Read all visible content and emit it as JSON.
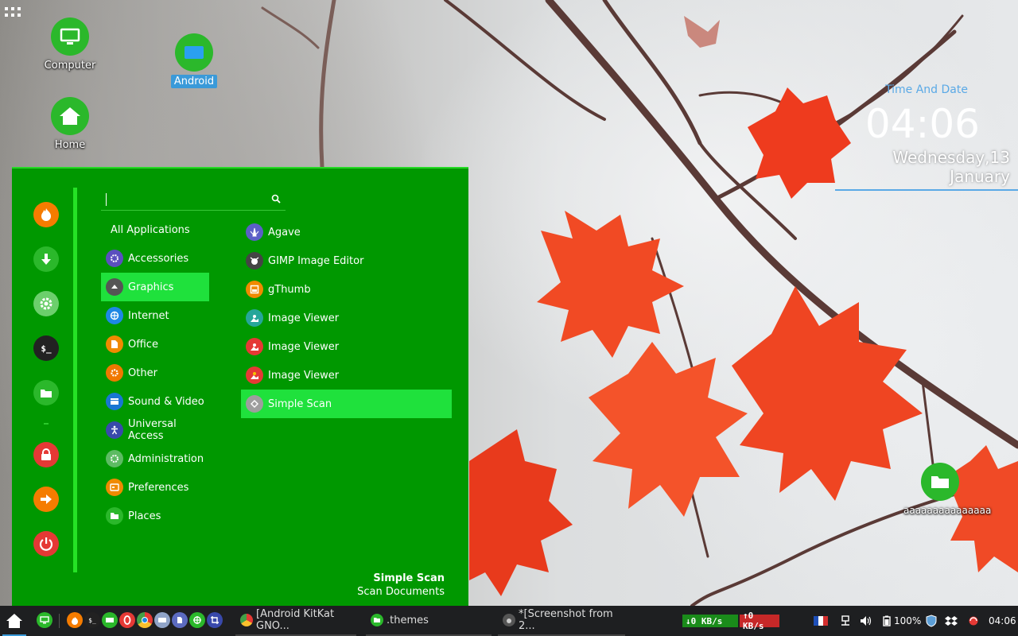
{
  "desktop": {
    "icons": [
      {
        "label": "Computer"
      },
      {
        "label": "Android"
      },
      {
        "label": "Home"
      },
      {
        "label": "aaaaaaaaaaaaaaa"
      }
    ]
  },
  "clock": {
    "title": "Time And Date",
    "time": "04:06",
    "date": "Wednesday,13 January"
  },
  "menu": {
    "search": {
      "value": "",
      "placeholder": ""
    },
    "categories": [
      {
        "label": "All Applications",
        "icon": "none"
      },
      {
        "label": "Accessories",
        "icon": "accessories-icon",
        "color": "#5b4fbf"
      },
      {
        "label": "Graphics",
        "icon": "graphics-icon",
        "color": "#555555",
        "active": true
      },
      {
        "label": "Internet",
        "icon": "internet-icon",
        "color": "#1e88e5"
      },
      {
        "label": "Office",
        "icon": "office-icon",
        "color": "#f08a00"
      },
      {
        "label": "Other",
        "icon": "other-icon",
        "color": "#f07800"
      },
      {
        "label": "Sound & Video",
        "icon": "sound-video-icon",
        "color": "#1976d2"
      },
      {
        "label": "Universal Access",
        "icon": "universal-access-icon",
        "color": "#3949ab"
      },
      {
        "label": "Administration",
        "icon": "administration-icon",
        "color": "#5dbb63"
      },
      {
        "label": "Preferences",
        "icon": "preferences-icon",
        "color": "#f08a00"
      },
      {
        "label": "Places",
        "icon": "places-icon",
        "color": "#2bb82b"
      }
    ],
    "apps": [
      {
        "label": "Agave",
        "icon": "agave-icon",
        "color": "#5b5fc7"
      },
      {
        "label": "GIMP Image Editor",
        "icon": "gimp-icon",
        "color": "#444444"
      },
      {
        "label": "gThumb",
        "icon": "gthumb-icon",
        "color": "#f08a00"
      },
      {
        "label": "Image Viewer",
        "icon": "image-viewer-icon",
        "color": "#26a69a"
      },
      {
        "label": "Image Viewer",
        "icon": "image-viewer-icon",
        "color": "#e53935"
      },
      {
        "label": "Image Viewer",
        "icon": "image-viewer-icon",
        "color": "#e53935"
      },
      {
        "label": "Simple Scan",
        "icon": "scanner-icon",
        "color": "#9e9e9e",
        "active": true
      }
    ],
    "footer": {
      "title": "Simple Scan",
      "subtitle": "Scan Documents"
    },
    "favorites": [
      {
        "icon": "firefox-icon",
        "color": "#f57c00"
      },
      {
        "icon": "download-icon",
        "color": "#2bb82b"
      },
      {
        "icon": "settings-icon",
        "color": "#6ccf6c"
      },
      {
        "icon": "terminal-icon",
        "color": "#222222"
      },
      {
        "icon": "folder-icon",
        "color": "#2bb82b"
      },
      {
        "icon": "lock-icon",
        "color": "#e53935"
      },
      {
        "icon": "logout-icon",
        "color": "#f57c00"
      },
      {
        "icon": "power-icon",
        "color": "#e53935"
      }
    ]
  },
  "taskbar": {
    "tasks": [
      {
        "label": "[Android KitKat GNO...",
        "icon": "chrome-icon"
      },
      {
        "label": ".themes",
        "icon": "folder-icon"
      },
      {
        "label": "*[Screenshot from 2...",
        "icon": "gimp-icon"
      }
    ],
    "net_down": "↓0 KB/s",
    "net_up": "↑0 KB/s",
    "battery": "100%",
    "time": "04:06",
    "colors": {
      "accent": "#3a9ad9",
      "menu_bg": "#009800",
      "highlight": "#1fe13c",
      "net_down": "#1fbf1f",
      "net_up": "#e53935"
    }
  }
}
